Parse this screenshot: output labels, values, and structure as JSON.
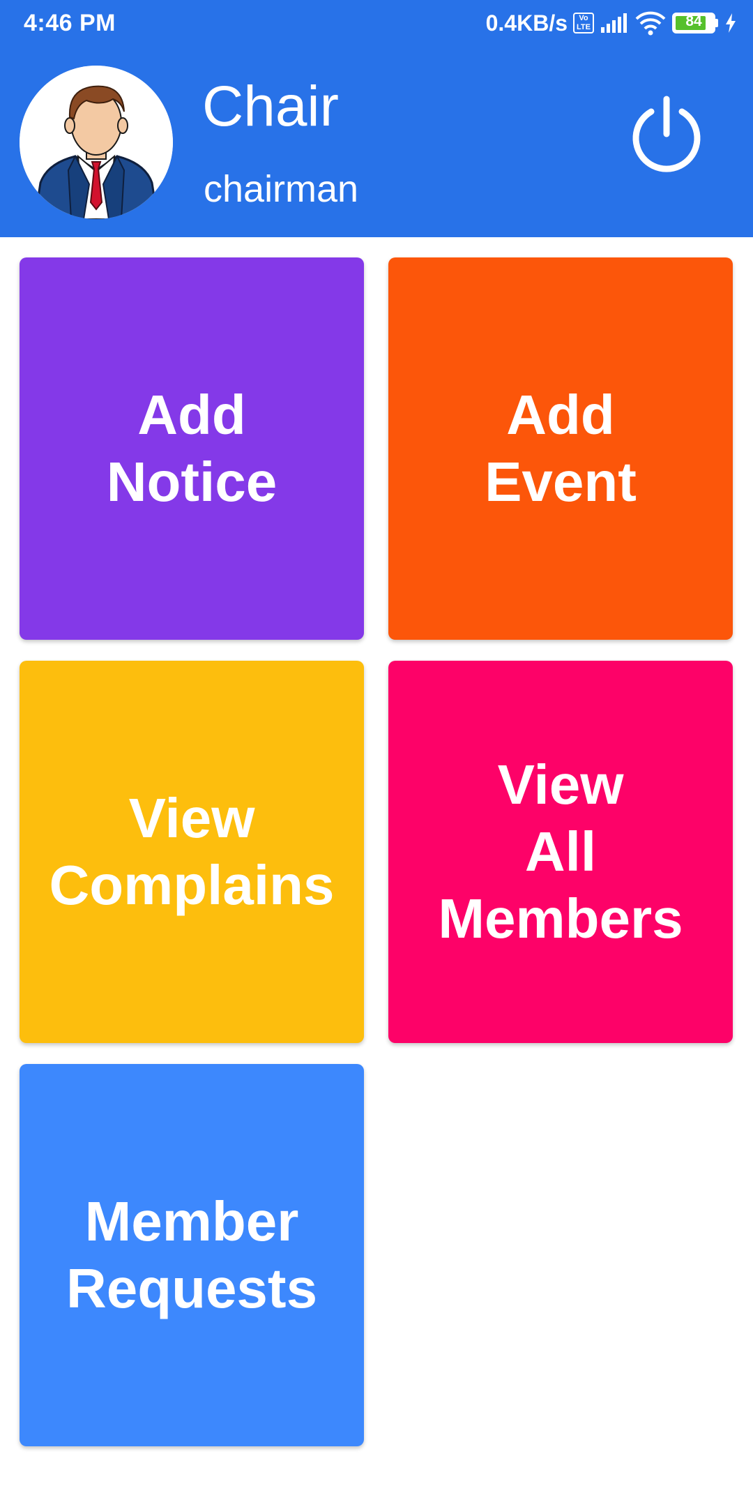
{
  "status_bar": {
    "time": "4:46 PM",
    "net_speed": "0.4KB/s",
    "volte": "Vo\nLTE",
    "battery_level": "84",
    "icons": [
      "volte-icon",
      "signal-icon",
      "wifi-icon",
      "battery-icon",
      "charging-icon"
    ]
  },
  "header": {
    "name": "Chair",
    "role": "chairman",
    "power_icon": "power-icon",
    "background_color": "#2872E8"
  },
  "tiles": [
    {
      "label": "Add\nNotice",
      "color": "#8439E8"
    },
    {
      "label": "Add\nEvent",
      "color": "#FC560A"
    },
    {
      "label": "View\nComplains",
      "color": "#FDBE0D"
    },
    {
      "label": "View\nAll\nMembers",
      "color": "#FD0268"
    },
    {
      "label": "Member\nRequests",
      "color": "#3D88FD"
    }
  ]
}
